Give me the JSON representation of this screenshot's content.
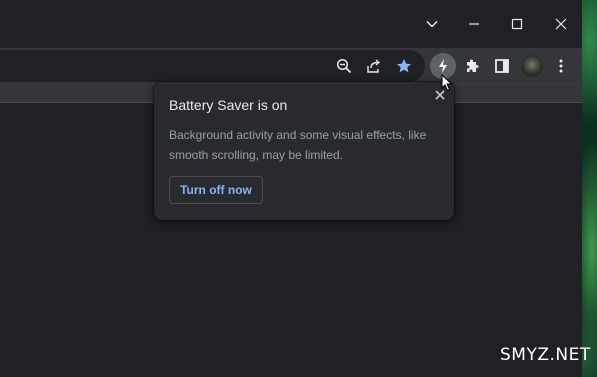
{
  "window_controls": {
    "tab_search": "chevron-down-icon",
    "minimize": "minimize-icon",
    "maximize": "maximize-icon",
    "close": "close-icon"
  },
  "toolbar": {
    "icons": [
      "zoom-out-icon",
      "share-icon",
      "bookmark-star-icon",
      "battery-saver-icon",
      "extensions-icon",
      "side-panel-icon",
      "profile-avatar",
      "menu-icon"
    ],
    "accent_color": "#8ab4f8"
  },
  "battery_popup": {
    "title": "Battery Saver is on",
    "body": "Background activity and some visual effects, like smooth scrolling, may be limited.",
    "button_label": "Turn off now"
  },
  "watermark": {
    "text": "SMYZ.NET"
  }
}
